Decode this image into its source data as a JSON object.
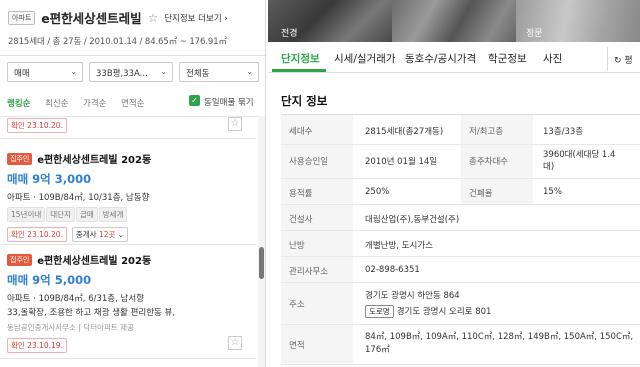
{
  "complex": {
    "badge": "아파트",
    "name": "e편한세상센트레빌",
    "more_info": "단지정보 더보기",
    "summary": "2815세대 / 총 27동 / 2010.01.14 / 84.65㎡ ~ 176.91㎡"
  },
  "filters": {
    "trade": "매매",
    "size": "33B평,33A...",
    "dong": "전체동"
  },
  "sort": {
    "options": [
      "랭킹순",
      "최신순",
      "가격순",
      "면적순"
    ],
    "same_listing_label": "동일매물 묶기"
  },
  "listings": [
    {
      "confirm": "확인 23.10.20."
    },
    {
      "owner_badge": "집주인",
      "name": "e편한세상센트레빌 202동",
      "price": "매매 9억 3,000",
      "spec": "아파트 · 109B/84㎡, 10/31층, 남동향",
      "tags": [
        "15년이내",
        "대단지",
        "급매",
        "방세개"
      ],
      "confirm": "확인 23.10.20.",
      "agent_label": "중개사",
      "agent_count": "12곳"
    },
    {
      "owner_badge": "집주인",
      "name": "e편한세상센트레빌 202동",
      "price": "매매 9억 5,000",
      "spec": "아파트 · 109B/84㎡, 6/31층, 남서향",
      "desc": "33,올확장, 조용한 하고 채광 생활 편리한동 뷰,",
      "source": "동남공인중개사사무소 | 닥터아파트 제공",
      "confirm": "확인 23.10.19."
    }
  ],
  "photos": [
    {
      "caption": "전경"
    },
    {
      "caption": ""
    },
    {
      "caption": "정문"
    }
  ],
  "tabs": [
    "단지정보",
    "시세/실거래가",
    "동호수/공시가격",
    "학군정보",
    "사진"
  ],
  "pin_label": "평",
  "info": {
    "title": "단지 정보",
    "households_label": "세대수",
    "households": "2815세대(총27개동)",
    "floors_label": "저/최고층",
    "floors": "13층/33층",
    "approval_label": "사용승인일",
    "approval": "2010년 01월 14일",
    "parking_label": "총주차대수",
    "parking": "3960대(세대당 1.4대)",
    "far_label": "용적률",
    "far": "250%",
    "bcr_label": "건폐율",
    "bcr": "15%",
    "builder_label": "건설사",
    "builder": "대림산업(주),동부건설(주)",
    "heating_label": "난방",
    "heating": "개별난방, 도시가스",
    "office_label": "관리사무소",
    "office": "02-898-6351",
    "address_label": "주소",
    "address": "경기도 광명시 하안동 864",
    "road_label": "도로명",
    "road_address": "경기도 광명시 오리로 801",
    "area_label": "면적",
    "areas": "84㎡, 109B㎡, 109A㎡, 110C㎡, 128㎡, 149B㎡, 150A㎡, 150C㎡, 176㎡"
  }
}
